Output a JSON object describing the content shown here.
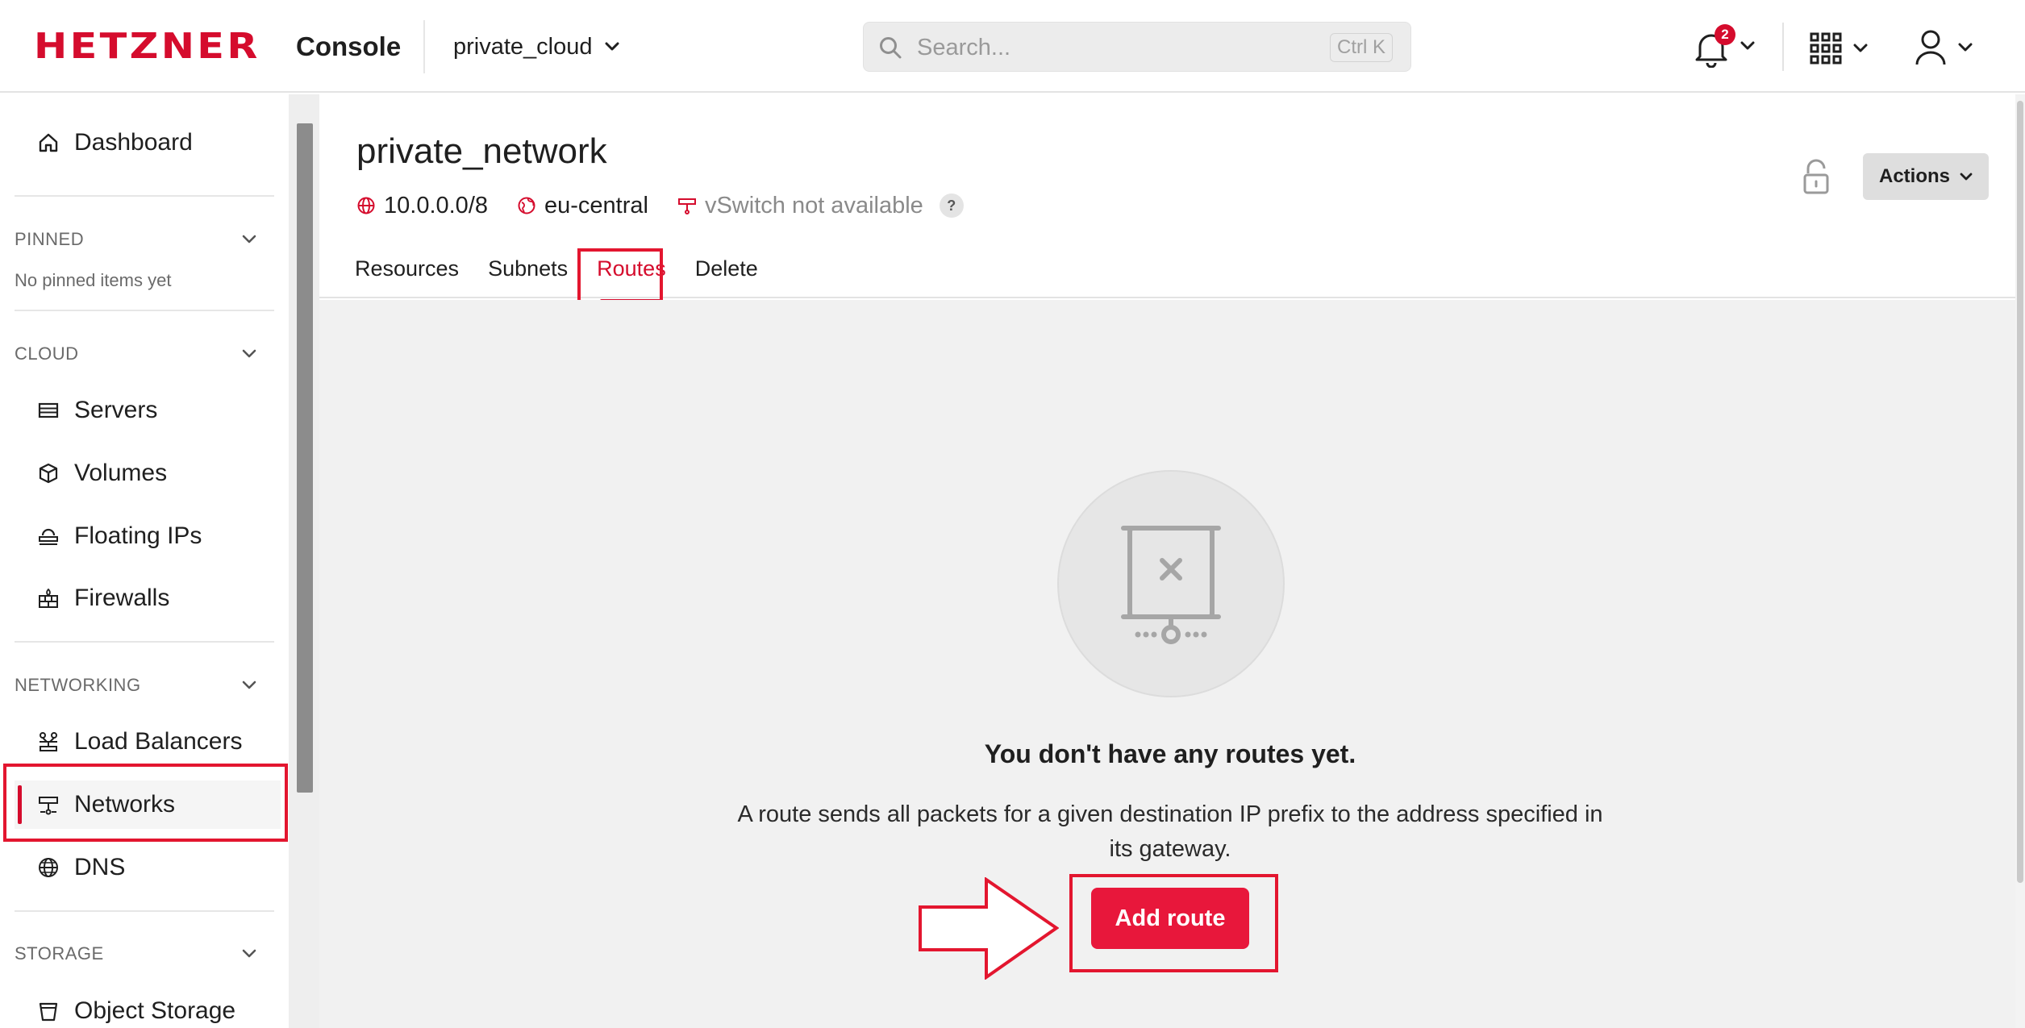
{
  "app": {
    "brand": "HETZNER",
    "product": "Console",
    "project": "private_cloud",
    "accent_color": "#d50c2d"
  },
  "search": {
    "placeholder": "Search...",
    "shortcut": "Ctrl K"
  },
  "header_icons": {
    "notifications": {
      "icon": "bell-icon",
      "count": "2"
    },
    "apps": {
      "icon": "grid-icon"
    },
    "user": {
      "icon": "user-icon"
    }
  },
  "sidebar": {
    "dashboard": "Dashboard",
    "pinned": {
      "title": "PINNED",
      "empty": "No pinned items yet"
    },
    "cloud": {
      "title": "CLOUD",
      "items": [
        "Servers",
        "Volumes",
        "Floating IPs",
        "Firewalls"
      ]
    },
    "networking": {
      "title": "NETWORKING",
      "items": [
        "Load Balancers",
        "Networks",
        "DNS"
      ]
    },
    "storage": {
      "title": "STORAGE",
      "items": [
        "Object Storage"
      ]
    },
    "active_item": "Networks"
  },
  "network": {
    "name": "private_network",
    "ip_range": "10.0.0.0/8",
    "zone": "eu-central",
    "vswitch": "vSwitch not available",
    "help": "?",
    "actions_label": "Actions"
  },
  "tabs": [
    "Resources",
    "Subnets",
    "Routes",
    "Delete"
  ],
  "active_tab": "Routes",
  "empty_state": {
    "title": "You don't have any routes yet.",
    "description": "A route sends all packets for a given destination IP prefix to the address specified in its gateway.",
    "button": "Add route"
  }
}
